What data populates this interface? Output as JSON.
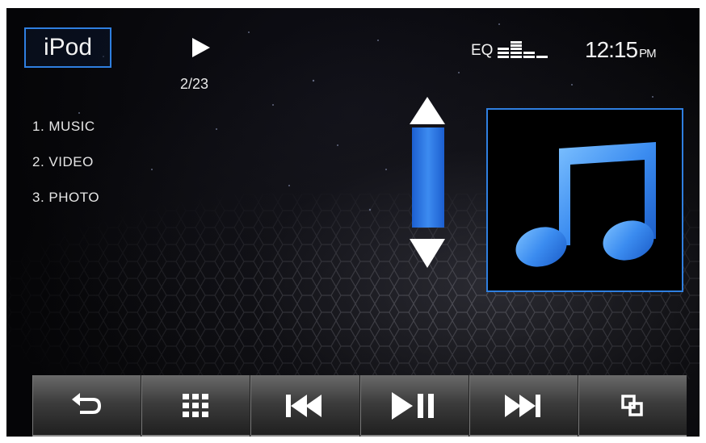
{
  "source": {
    "label": "iPod"
  },
  "playback": {
    "state_icon": "play-icon",
    "track_count": "2/23"
  },
  "eq": {
    "label": "EQ",
    "icon": "equalizer-icon"
  },
  "clock": {
    "time": "12:15",
    "meridiem": "PM"
  },
  "menu": {
    "items": [
      {
        "label": "1. MUSIC"
      },
      {
        "label": "2. VIDEO"
      },
      {
        "label": "3. PHOTO"
      }
    ]
  },
  "scroll": {
    "up_icon": "scroll-up-arrow-icon",
    "down_icon": "scroll-down-arrow-icon"
  },
  "album_art": {
    "icon": "music-note-icon",
    "accent": "#3b8cf0"
  },
  "toolbar": {
    "buttons": [
      {
        "icon": "back-icon"
      },
      {
        "icon": "menu-grid-icon"
      },
      {
        "icon": "previous-track-icon"
      },
      {
        "icon": "play-pause-icon"
      },
      {
        "icon": "next-track-icon"
      },
      {
        "icon": "window-switch-icon"
      }
    ]
  },
  "colors": {
    "accent": "#2f7fe0",
    "text": "#f2f2f2",
    "background": "#050507"
  }
}
